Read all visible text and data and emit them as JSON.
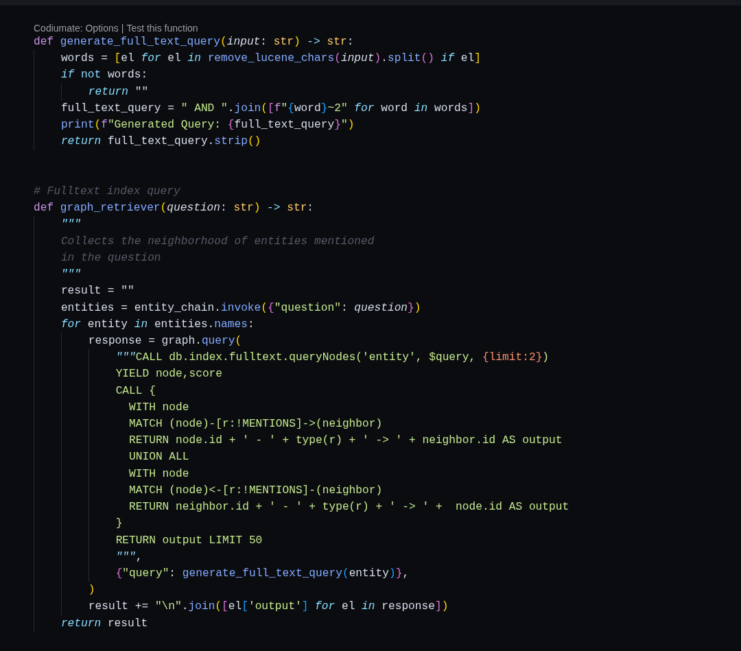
{
  "codelens": {
    "items": [
      "Codiumate: Options",
      "Test this function"
    ],
    "separator": "|"
  },
  "lines": [
    {
      "kind": "code",
      "segments": [
        {
          "text": "def",
          "kind": "kw"
        },
        {
          "text": " generate_full_text_query",
          "kind": "fn"
        },
        {
          "text": "(",
          "kind": "b1"
        },
        {
          "text": "input",
          "kind": "param"
        },
        {
          "text": ": ",
          "kind": "p"
        },
        {
          "text": "str",
          "kind": "type"
        },
        {
          "text": ")",
          "kind": "b1"
        },
        {
          "text": " -> ",
          "kind": "op"
        },
        {
          "text": "str",
          "kind": "type"
        },
        {
          "text": ":",
          "kind": "p"
        }
      ],
      "children": [
        {
          "kind": "code",
          "segments": [
            {
              "text": "words = ",
              "kind": "p"
            },
            {
              "text": "[",
              "kind": "b1"
            },
            {
              "text": "el ",
              "kind": "p"
            },
            {
              "text": "for",
              "kind": "ctrl"
            },
            {
              "text": " el ",
              "kind": "p"
            },
            {
              "text": "in",
              "kind": "ctrl"
            },
            {
              "text": " remove_lucene_chars",
              "kind": "fn"
            },
            {
              "text": "(",
              "kind": "b2"
            },
            {
              "text": "input",
              "kind": "param"
            },
            {
              "text": ")",
              "kind": "b2"
            },
            {
              "text": ".",
              "kind": "p"
            },
            {
              "text": "split",
              "kind": "fn"
            },
            {
              "text": "()",
              "kind": "b2"
            },
            {
              "text": " if",
              "kind": "ctrl"
            },
            {
              "text": " el",
              "kind": "p"
            },
            {
              "text": "]",
              "kind": "b1"
            }
          ]
        },
        {
          "kind": "code",
          "segments": [
            {
              "text": "if",
              "kind": "ctrl"
            },
            {
              "text": " not",
              "kind": "op"
            },
            {
              "text": " words:",
              "kind": "p"
            }
          ],
          "children": [
            {
              "kind": "code",
              "segments": [
                {
                  "text": "return",
                  "kind": "ctrl"
                },
                {
                  "text": " \"\"",
                  "kind": "p"
                }
              ]
            }
          ]
        },
        {
          "kind": "code",
          "segments": [
            {
              "text": "full_text_query = ",
              "kind": "p"
            },
            {
              "text": "\" AND \"",
              "kind": "str"
            },
            {
              "text": ".",
              "kind": "p"
            },
            {
              "text": "join",
              "kind": "fn"
            },
            {
              "text": "(",
              "kind": "b1"
            },
            {
              "text": "[",
              "kind": "b2"
            },
            {
              "text": "f",
              "kind": "kw"
            },
            {
              "text": "\"",
              "kind": "str"
            },
            {
              "text": "{",
              "kind": "b3"
            },
            {
              "text": "word",
              "kind": "p"
            },
            {
              "text": "}",
              "kind": "b3"
            },
            {
              "text": "~2\" ",
              "kind": "str"
            },
            {
              "text": "for",
              "kind": "ctrl"
            },
            {
              "text": " word ",
              "kind": "p"
            },
            {
              "text": "in",
              "kind": "ctrl"
            },
            {
              "text": " words",
              "kind": "p"
            },
            {
              "text": "]",
              "kind": "b2"
            },
            {
              "text": ")",
              "kind": "b1"
            }
          ]
        },
        {
          "kind": "code",
          "segments": [
            {
              "text": "print",
              "kind": "fn"
            },
            {
              "text": "(",
              "kind": "b1"
            },
            {
              "text": "f",
              "kind": "kw"
            },
            {
              "text": "\"Generated Query: ",
              "kind": "str"
            },
            {
              "text": "{",
              "kind": "b2"
            },
            {
              "text": "full_text_query",
              "kind": "p"
            },
            {
              "text": "}",
              "kind": "b2"
            },
            {
              "text": "\"",
              "kind": "str"
            },
            {
              "text": ")",
              "kind": "b1"
            }
          ]
        },
        {
          "kind": "code",
          "segments": [
            {
              "text": "return",
              "kind": "ctrl"
            },
            {
              "text": " full_text_query.",
              "kind": "p"
            },
            {
              "text": "strip",
              "kind": "fn"
            },
            {
              "text": "()",
              "kind": "b1"
            }
          ]
        }
      ]
    },
    {
      "kind": "blank"
    },
    {
      "kind": "blank"
    },
    {
      "kind": "code",
      "segments": [
        {
          "text": "# Fulltext index query",
          "kind": "cmt"
        }
      ]
    },
    {
      "kind": "code",
      "segments": [
        {
          "text": "def",
          "kind": "kw"
        },
        {
          "text": " graph_retriever",
          "kind": "fn"
        },
        {
          "text": "(",
          "kind": "b1"
        },
        {
          "text": "question",
          "kind": "param"
        },
        {
          "text": ": ",
          "kind": "p"
        },
        {
          "text": "str",
          "kind": "type"
        },
        {
          "text": ")",
          "kind": "b1"
        },
        {
          "text": " -> ",
          "kind": "op"
        },
        {
          "text": "str",
          "kind": "type"
        },
        {
          "text": ":",
          "kind": "p"
        }
      ],
      "children": [
        {
          "kind": "code",
          "segments": [
            {
              "text": "\"\"\"",
              "kind": "doc"
            }
          ]
        },
        {
          "kind": "code",
          "segments": [
            {
              "text": "Collects the neighborhood of entities mentioned",
              "kind": "cmt"
            }
          ]
        },
        {
          "kind": "code",
          "segments": [
            {
              "text": "in the question",
              "kind": "cmt"
            }
          ]
        },
        {
          "kind": "code",
          "segments": [
            {
              "text": "\"\"\"",
              "kind": "doc"
            }
          ]
        },
        {
          "kind": "code",
          "segments": [
            {
              "text": "result = \"\"",
              "kind": "p"
            }
          ]
        },
        {
          "kind": "code",
          "segments": [
            {
              "text": "entities = entity_chain.",
              "kind": "p"
            },
            {
              "text": "invoke",
              "kind": "fn"
            },
            {
              "text": "(",
              "kind": "b1"
            },
            {
              "text": "{",
              "kind": "b2"
            },
            {
              "text": "\"question\"",
              "kind": "str"
            },
            {
              "text": ": ",
              "kind": "p"
            },
            {
              "text": "question",
              "kind": "param"
            },
            {
              "text": "}",
              "kind": "b2"
            },
            {
              "text": ")",
              "kind": "b1"
            }
          ]
        },
        {
          "kind": "code",
          "segments": [
            {
              "text": "for",
              "kind": "ctrl"
            },
            {
              "text": " entity ",
              "kind": "p"
            },
            {
              "text": "in",
              "kind": "ctrl"
            },
            {
              "text": " entities.",
              "kind": "p"
            },
            {
              "text": "names",
              "kind": "fn"
            },
            {
              "text": ":",
              "kind": "p"
            }
          ],
          "children": [
            {
              "kind": "code",
              "segments": [
                {
                  "text": "response = graph.",
                  "kind": "p"
                },
                {
                  "text": "query",
                  "kind": "fn"
                },
                {
                  "text": "(",
                  "kind": "b1"
                }
              ],
              "children": [
                {
                  "kind": "code",
                  "segments": [
                    {
                      "text": "\"\"\"",
                      "kind": "doc"
                    },
                    {
                      "text": "CALL db.index.fulltext.queryNodes('entity', $query, ",
                      "kind": "str"
                    },
                    {
                      "text": "{limit:2}",
                      "kind": "num"
                    },
                    {
                      "text": ")",
                      "kind": "str"
                    }
                  ]
                },
                {
                  "kind": "code",
                  "segments": [
                    {
                      "text": "YIELD node,score",
                      "kind": "str"
                    }
                  ]
                },
                {
                  "kind": "code",
                  "segments": [
                    {
                      "text": "CALL {",
                      "kind": "str"
                    }
                  ]
                },
                {
                  "kind": "code",
                  "segments": [
                    {
                      "text": "  WITH node",
                      "kind": "str"
                    }
                  ]
                },
                {
                  "kind": "code",
                  "segments": [
                    {
                      "text": "  MATCH (node)-[r:!MENTIONS]->(neighbor)",
                      "kind": "str"
                    }
                  ]
                },
                {
                  "kind": "code",
                  "segments": [
                    {
                      "text": "  RETURN node.id + ' - ' + type(r) + ' -> ' + neighbor.id AS output",
                      "kind": "str"
                    }
                  ]
                },
                {
                  "kind": "code",
                  "segments": [
                    {
                      "text": "  UNION ALL",
                      "kind": "str"
                    }
                  ]
                },
                {
                  "kind": "code",
                  "segments": [
                    {
                      "text": "  WITH node",
                      "kind": "str"
                    }
                  ]
                },
                {
                  "kind": "code",
                  "segments": [
                    {
                      "text": "  MATCH (node)<-[r:!MENTIONS]-(neighbor)",
                      "kind": "str"
                    }
                  ]
                },
                {
                  "kind": "code",
                  "segments": [
                    {
                      "text": "  RETURN neighbor.id + ' - ' + type(r) + ' -> ' +  node.id AS output",
                      "kind": "str"
                    }
                  ]
                },
                {
                  "kind": "code",
                  "segments": [
                    {
                      "text": "}",
                      "kind": "str"
                    }
                  ]
                },
                {
                  "kind": "code",
                  "segments": [
                    {
                      "text": "RETURN output LIMIT 50",
                      "kind": "str"
                    }
                  ]
                },
                {
                  "kind": "code",
                  "segments": [
                    {
                      "text": "\"\"\"",
                      "kind": "doc"
                    },
                    {
                      "text": ",",
                      "kind": "p"
                    }
                  ]
                },
                {
                  "kind": "code",
                  "segments": [
                    {
                      "text": "{",
                      "kind": "b2"
                    },
                    {
                      "text": "\"query\"",
                      "kind": "str"
                    },
                    {
                      "text": ": ",
                      "kind": "p"
                    },
                    {
                      "text": "generate_full_text_query",
                      "kind": "fn"
                    },
                    {
                      "text": "(",
                      "kind": "b3"
                    },
                    {
                      "text": "entity",
                      "kind": "p"
                    },
                    {
                      "text": ")",
                      "kind": "b3"
                    },
                    {
                      "text": "}",
                      "kind": "b2"
                    },
                    {
                      "text": ",",
                      "kind": "p"
                    }
                  ]
                }
              ]
            },
            {
              "kind": "code",
              "segments": [
                {
                  "text": ")",
                  "kind": "b1"
                }
              ]
            },
            {
              "kind": "code",
              "segments": [
                {
                  "text": "result += ",
                  "kind": "p"
                },
                {
                  "text": "\"\\n\"",
                  "kind": "str"
                },
                {
                  "text": ".",
                  "kind": "p"
                },
                {
                  "text": "join",
                  "kind": "fn"
                },
                {
                  "text": "(",
                  "kind": "b1"
                },
                {
                  "text": "[",
                  "kind": "b2"
                },
                {
                  "text": "el",
                  "kind": "p"
                },
                {
                  "text": "[",
                  "kind": "b3"
                },
                {
                  "text": "'output'",
                  "kind": "str"
                },
                {
                  "text": "]",
                  "kind": "b3"
                },
                {
                  "text": " for",
                  "kind": "ctrl"
                },
                {
                  "text": " el ",
                  "kind": "p"
                },
                {
                  "text": "in",
                  "kind": "ctrl"
                },
                {
                  "text": " response",
                  "kind": "p"
                },
                {
                  "text": "]",
                  "kind": "b2"
                },
                {
                  "text": ")",
                  "kind": "b1"
                }
              ]
            }
          ]
        },
        {
          "kind": "code",
          "segments": [
            {
              "text": "return",
              "kind": "ctrl"
            },
            {
              "text": " result",
              "kind": "p"
            }
          ]
        }
      ]
    }
  ]
}
